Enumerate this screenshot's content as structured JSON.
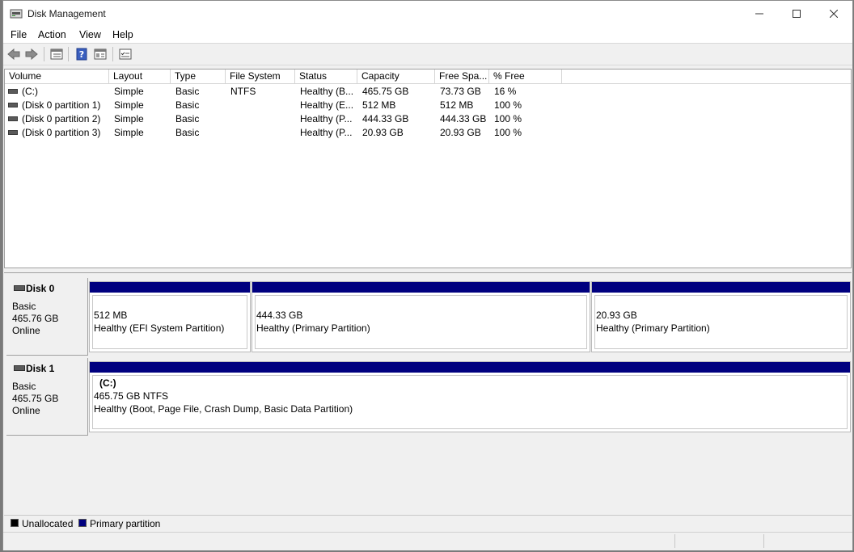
{
  "window": {
    "title": "Disk Management"
  },
  "menu": [
    "File",
    "Action",
    "View",
    "Help"
  ],
  "icons": {
    "back": "back-arrow-icon",
    "forward": "forward-arrow-icon",
    "list": "volume-list-icon",
    "help": "help-icon",
    "properties": "properties-icon",
    "settings": "settings-icon"
  },
  "columns": [
    "Volume",
    "Layout",
    "Type",
    "File System",
    "Status",
    "Capacity",
    "Free Spa...",
    "% Free"
  ],
  "volumes": [
    {
      "volume": "(C:)",
      "layout": "Simple",
      "type": "Basic",
      "fs": "NTFS",
      "status": "Healthy (B...",
      "capacity": "465.75 GB",
      "free": "73.73 GB",
      "pct": "16 %"
    },
    {
      "volume": "(Disk 0 partition 1)",
      "layout": "Simple",
      "type": "Basic",
      "fs": "",
      "status": "Healthy (E...",
      "capacity": "512 MB",
      "free": "512 MB",
      "pct": "100 %"
    },
    {
      "volume": "(Disk 0 partition 2)",
      "layout": "Simple",
      "type": "Basic",
      "fs": "",
      "status": "Healthy (P...",
      "capacity": "444.33 GB",
      "free": "444.33 GB",
      "pct": "100 %"
    },
    {
      "volume": "(Disk 0 partition 3)",
      "layout": "Simple",
      "type": "Basic",
      "fs": "",
      "status": "Healthy (P...",
      "capacity": "20.93 GB",
      "free": "20.93 GB",
      "pct": "100 %"
    }
  ],
  "disks": [
    {
      "name": "Disk 0",
      "type": "Basic",
      "size": "465.76 GB",
      "state": "Online",
      "partitions": [
        {
          "title": "",
          "size": "512 MB",
          "status": "Healthy (EFI System Partition)"
        },
        {
          "title": "",
          "size": "444.33 GB",
          "status": "Healthy (Primary Partition)"
        },
        {
          "title": "",
          "size": "20.93 GB",
          "status": "Healthy (Primary Partition)"
        }
      ]
    },
    {
      "name": "Disk 1",
      "type": "Basic",
      "size": "465.75 GB",
      "state": "Online",
      "partitions": [
        {
          "title": "(C:)",
          "size": "465.75 GB NTFS",
          "status": "Healthy (Boot, Page File, Crash Dump, Basic Data Partition)"
        }
      ]
    }
  ],
  "legend": [
    {
      "label": "Unallocated",
      "color": "#000000"
    },
    {
      "label": "Primary partition",
      "color": "#00007f"
    }
  ],
  "colors": {
    "partition_bar": "#00007f"
  }
}
